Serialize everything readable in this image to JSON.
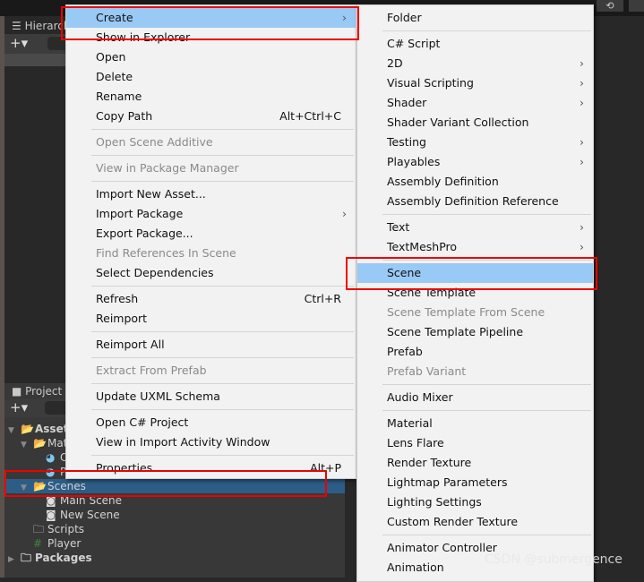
{
  "hierarchy": {
    "tab": "Hierarchy",
    "add": "+▾"
  },
  "project": {
    "tab": "Project",
    "add": "+▾",
    "tree": [
      {
        "label": "Assets",
        "indent": 0,
        "bold": true,
        "icon": "folder-open-icon",
        "arrow": "▼"
      },
      {
        "label": "Materials",
        "indent": 1,
        "icon": "folder-open-icon",
        "arrow": "▼"
      },
      {
        "label": "Cube",
        "indent": 2,
        "icon": "material-icon",
        "arrow": ""
      },
      {
        "label": "Plane",
        "indent": 2,
        "icon": "material-icon",
        "arrow": ""
      },
      {
        "label": "Scenes",
        "indent": 1,
        "icon": "folder-open-icon",
        "arrow": "▼",
        "selected": true
      },
      {
        "label": "Main Scene",
        "indent": 2,
        "icon": "unity-scene-icon",
        "arrow": ""
      },
      {
        "label": "New Scene",
        "indent": 2,
        "icon": "unity-scene-icon",
        "arrow": ""
      },
      {
        "label": "Scripts",
        "indent": 1,
        "icon": "folder-icon",
        "arrow": ""
      },
      {
        "label": "Player",
        "indent": 1,
        "icon": "csharp-script-icon",
        "arrow": ""
      },
      {
        "label": "Packages",
        "indent": 0,
        "bold": true,
        "icon": "folder-icon",
        "arrow": "▶"
      }
    ]
  },
  "context_menu": [
    {
      "label": "Create",
      "submenu": true,
      "highlight": true
    },
    {
      "label": "Show in Explorer"
    },
    {
      "label": "Open"
    },
    {
      "label": "Delete"
    },
    {
      "label": "Rename"
    },
    {
      "label": "Copy Path",
      "shortcut": "Alt+Ctrl+C"
    },
    {
      "sep": true
    },
    {
      "label": "Open Scene Additive",
      "disabled": true
    },
    {
      "sep": true
    },
    {
      "label": "View in Package Manager",
      "disabled": true
    },
    {
      "sep": true
    },
    {
      "label": "Import New Asset..."
    },
    {
      "label": "Import Package",
      "submenu": true
    },
    {
      "label": "Export Package..."
    },
    {
      "label": "Find References In Scene",
      "disabled": true
    },
    {
      "label": "Select Dependencies"
    },
    {
      "sep": true
    },
    {
      "label": "Refresh",
      "shortcut": "Ctrl+R"
    },
    {
      "label": "Reimport"
    },
    {
      "sep": true
    },
    {
      "label": "Reimport All"
    },
    {
      "sep": true
    },
    {
      "label": "Extract From Prefab",
      "disabled": true
    },
    {
      "sep": true
    },
    {
      "label": "Update UXML Schema"
    },
    {
      "sep": true
    },
    {
      "label": "Open C# Project"
    },
    {
      "label": "View in Import Activity Window"
    },
    {
      "sep": true
    },
    {
      "label": "Properties...",
      "shortcut": "Alt+P"
    }
  ],
  "create_submenu": [
    {
      "label": "Folder"
    },
    {
      "sep": true
    },
    {
      "label": "C# Script"
    },
    {
      "label": "2D",
      "submenu": true
    },
    {
      "label": "Visual Scripting",
      "submenu": true
    },
    {
      "label": "Shader",
      "submenu": true
    },
    {
      "label": "Shader Variant Collection"
    },
    {
      "label": "Testing",
      "submenu": true
    },
    {
      "label": "Playables",
      "submenu": true
    },
    {
      "label": "Assembly Definition"
    },
    {
      "label": "Assembly Definition Reference"
    },
    {
      "sep": true
    },
    {
      "label": "Text",
      "submenu": true
    },
    {
      "label": "TextMeshPro",
      "submenu": true
    },
    {
      "sep": true
    },
    {
      "label": "Scene",
      "highlight": true
    },
    {
      "label": "Scene Template"
    },
    {
      "label": "Scene Template From Scene",
      "disabled": true
    },
    {
      "label": "Scene Template Pipeline"
    },
    {
      "label": "Prefab"
    },
    {
      "label": "Prefab Variant",
      "disabled": true
    },
    {
      "sep": true
    },
    {
      "label": "Audio Mixer"
    },
    {
      "sep": true
    },
    {
      "label": "Material"
    },
    {
      "label": "Lens Flare"
    },
    {
      "label": "Render Texture"
    },
    {
      "label": "Lightmap Parameters"
    },
    {
      "label": "Lighting Settings"
    },
    {
      "label": "Custom Render Texture"
    },
    {
      "sep": true
    },
    {
      "label": "Animator Controller"
    },
    {
      "label": "Animation"
    }
  ],
  "watermark": "CSDN @submergence",
  "colors": {
    "highlight": "#99c9f5",
    "annotation": "#e00000",
    "selection": "#2c5d87"
  }
}
